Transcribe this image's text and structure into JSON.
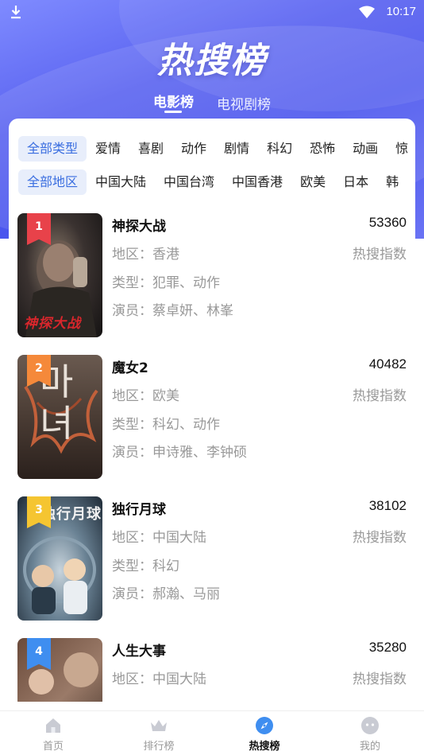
{
  "status_bar": {
    "time": "10:17"
  },
  "page_title": "热搜榜",
  "top_tabs": [
    {
      "label": "电影榜",
      "active": true
    },
    {
      "label": "电视剧榜",
      "active": false
    }
  ],
  "type_filters": [
    "全部类型",
    "爱情",
    "喜剧",
    "动作",
    "剧情",
    "科幻",
    "恐怖",
    "动画",
    "惊"
  ],
  "region_filters": [
    "全部地区",
    "中国大陆",
    "中国台湾",
    "中国香港",
    "欧美",
    "日本",
    "韩"
  ],
  "movies": [
    {
      "rank": "1",
      "title": "神探大战",
      "score": "53360",
      "region": "地区：香港",
      "index_label": "热搜指数",
      "genre": "类型：犯罪、动作",
      "cast": "演员：蔡卓妍、林峯",
      "poster_text": "神探大战"
    },
    {
      "rank": "2",
      "title": "魔女2",
      "score": "40482",
      "region": "地区：欧美",
      "index_label": "热搜指数",
      "genre": "类型：科幻、动作",
      "cast": "演员：申诗雅、李钟硕",
      "poster_text": "마녀"
    },
    {
      "rank": "3",
      "title": "独行月球",
      "score": "38102",
      "region": "地区：中国大陆",
      "index_label": "热搜指数",
      "genre": "类型：科幻",
      "cast": "演员：郝瀚、马丽",
      "poster_text": "独行月球"
    },
    {
      "rank": "4",
      "title": "人生大事",
      "score": "35280",
      "region": "地区：中国大陆",
      "index_label": "热搜指数",
      "genre": "",
      "cast": "",
      "poster_text": ""
    }
  ],
  "rank_colors": [
    "#e8424a",
    "#f5893a",
    "#f5c531",
    "#3f8ef0"
  ],
  "bottom_nav": [
    {
      "label": "首页",
      "icon": "home-icon",
      "active": false
    },
    {
      "label": "排行榜",
      "icon": "crown-icon",
      "active": false
    },
    {
      "label": "热搜榜",
      "icon": "compass-icon",
      "active": true
    },
    {
      "label": "我的",
      "icon": "profile-icon",
      "active": false
    }
  ],
  "accent_color": "#3a6ee0"
}
